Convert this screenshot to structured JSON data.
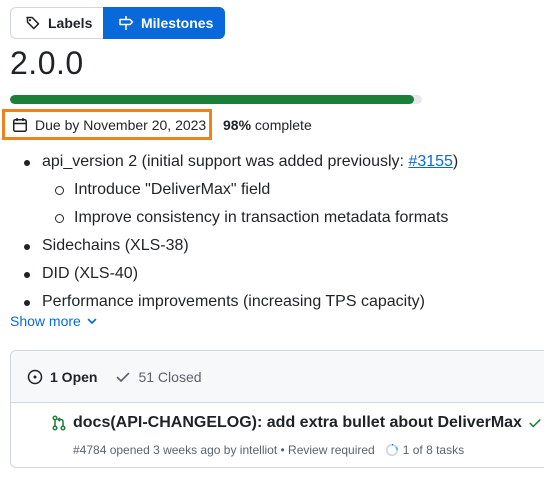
{
  "tabs": {
    "labels": "Labels",
    "milestones": "Milestones"
  },
  "milestone": {
    "title": "2.0.0",
    "progress_percent": 98,
    "due": "Due by November 20, 2023",
    "percent_text": "98%",
    "complete_text": "complete"
  },
  "description": {
    "item1_text": "api_version 2 (initial support was added previously: ",
    "item1_link": "#3155",
    "item1_close": ")",
    "sub1": "Introduce \"DeliverMax\" field",
    "sub2": "Improve consistency in transaction metadata formats",
    "item2": "Sidechains (XLS-38)",
    "item3": "DID (XLS-40)",
    "item4": "Performance improvements (increasing TPS capacity)"
  },
  "show_more": "Show more",
  "issues": {
    "open_label": "1 Open",
    "closed_label": "51 Closed",
    "row": {
      "title": "docs(API-CHANGELOG): add extra bullet about DeliverMax",
      "meta": "#4784 opened 3 weeks ago by intelliot • Review required",
      "tasks": "1 of 8 tasks"
    }
  },
  "colors": {
    "accent": "#0969da",
    "success": "#1a7f37",
    "highlight": "#f0821e"
  }
}
